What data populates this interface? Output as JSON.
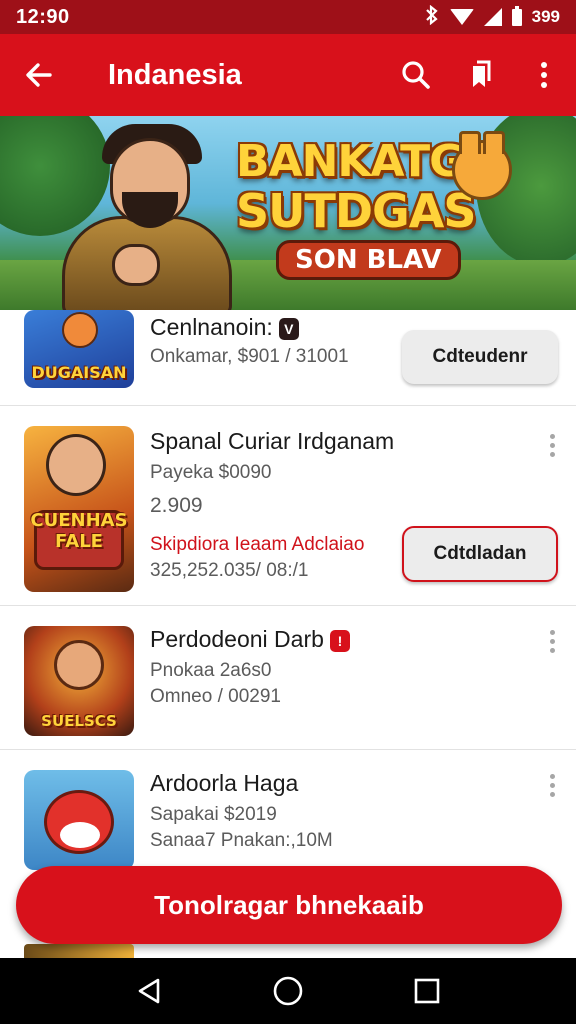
{
  "status_bar": {
    "time": "12:90",
    "icons": [
      "bluetooth-icon",
      "wifi-icon",
      "signal-icon",
      "battery-icon"
    ],
    "battery_text": "399"
  },
  "app_bar": {
    "title": "Indanesia",
    "actions": [
      "search-icon",
      "bookmark-icon",
      "more-vert-icon"
    ]
  },
  "banner": {
    "title_line1": "BANKATG",
    "title_line2": "SUTDGAS",
    "subtitle": "SON BLAV"
  },
  "list": [
    {
      "thumb_label": "DUGAISAN",
      "name": "Cenlnanoin:",
      "name_badge": "V",
      "line1": "Onkamar, $901 / 31001",
      "button": "Cdteudenr"
    },
    {
      "thumb_label": "CUENHAS FALE",
      "name": "Spanal Curiar Irdganam",
      "line1": "Payeka $0090",
      "line2": "2.909",
      "red_line": "Skipdiora Ieaam Adclaiao",
      "line3": "325,252.035/ 08:/1",
      "button": "Cdtdladan"
    },
    {
      "thumb_label": "SUELSCS",
      "name": "Perdodeoni Darb",
      "name_badge": "!",
      "line1": "Pnokaa 2a6s0",
      "line2": "Omneo / 00291"
    },
    {
      "thumb_label": "",
      "name": "Ardoorla Haga",
      "line1": "Sapakai $2019",
      "line2": "Sanaa7 Pnakan:,10M"
    }
  ],
  "cta": {
    "label": "Tonolragar bhnekaaib"
  },
  "nav_bar": [
    "back-icon",
    "home-icon",
    "recents-icon"
  ],
  "colors": {
    "primary": "#d8111b",
    "status_bar": "#9e1018",
    "accent": "#f6c52c",
    "nav_bar": "#000000"
  }
}
